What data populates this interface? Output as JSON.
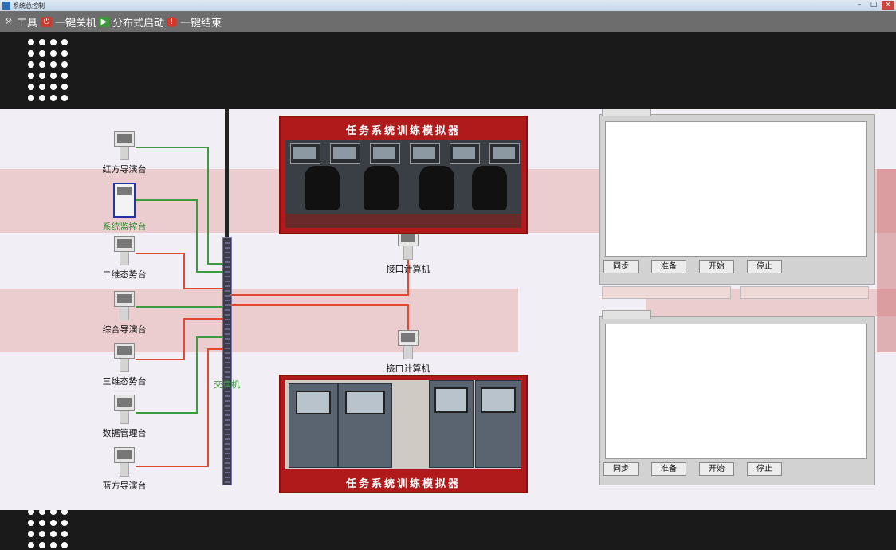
{
  "window": {
    "title": "系统总控制"
  },
  "toolbar": {
    "items": [
      {
        "label": "工具",
        "icon": "tools-icon"
      },
      {
        "label": "一键关机",
        "icon": "shutdown-icon"
      },
      {
        "label": "分布式启动",
        "icon": "distributed-start-icon"
      },
      {
        "label": "一键结束",
        "icon": "stop-all-icon"
      }
    ]
  },
  "stations": [
    {
      "label": "红方导演台"
    },
    {
      "label": "系统监控台",
      "selected": true
    },
    {
      "label": "二维态势台"
    },
    {
      "label": "综合导演台"
    },
    {
      "label": "三维态势台"
    },
    {
      "label": "数据管理台"
    },
    {
      "label": "蓝方导演台"
    }
  ],
  "switch": {
    "label": "交换机"
  },
  "gateways": [
    {
      "label": "接口计算机"
    },
    {
      "label": "接口计算机"
    }
  ],
  "simulators": [
    {
      "caption": "任务系统训练模拟器"
    },
    {
      "caption": "任务系统训练模拟器"
    }
  ],
  "panels": [
    {
      "buttons": [
        "同步",
        "准备",
        "开始",
        "停止"
      ]
    },
    {
      "buttons": [
        "同步",
        "准备",
        "开始",
        "停止"
      ]
    }
  ],
  "colors": {
    "link_green": "#3e9a3e",
    "link_red": "#e04a30",
    "caption_bg": "#b01a1a",
    "selected_border": "#2233aa"
  }
}
